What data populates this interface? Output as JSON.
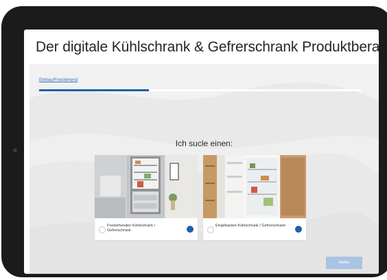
{
  "app": {
    "title": "Der digitale Kühlschrank & Gefrerschrank Produktberater"
  },
  "stepper": {
    "step_label": "Einbau/Freistehend",
    "progress": 0.34
  },
  "question": {
    "text": "Ich sucle einen:"
  },
  "options": [
    {
      "label": "Freistehenden Kühlschrank / Gefrerschrank",
      "selected": false
    },
    {
      "label": "Eingebauten Kühlschrank / Gefrerschrank",
      "selected": false
    }
  ],
  "actions": {
    "next_label": "Weiter"
  },
  "colors": {
    "accent": "#1f5faa",
    "button_disabled": "#a9c3e3",
    "background": "#e9e9e9"
  },
  "icons": {
    "option_info": "info-dot-icon"
  }
}
